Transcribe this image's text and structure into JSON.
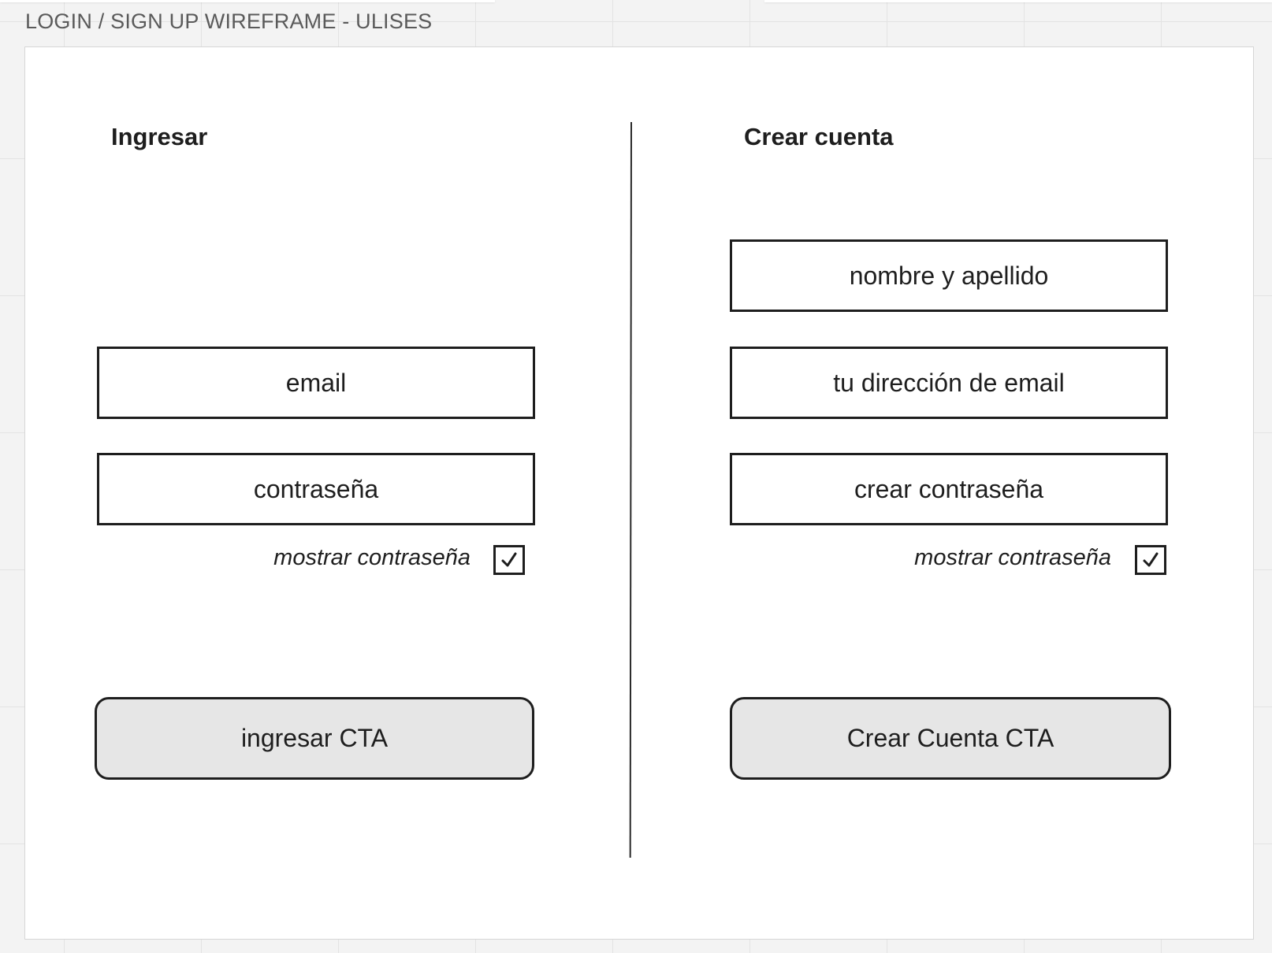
{
  "frame": {
    "title": "LOGIN / SIGN UP WIREFRAME - ULISES"
  },
  "login": {
    "heading": "Ingresar",
    "email_placeholder": "email",
    "password_placeholder": "contraseña",
    "show_password_label": "mostrar contraseña",
    "show_password_checked": true,
    "submit_label": "ingresar CTA"
  },
  "signup": {
    "heading": "Crear cuenta",
    "name_placeholder": "nombre y apellido",
    "email_placeholder": "tu dirección de email",
    "password_placeholder": "crear contraseña",
    "show_password_label": "mostrar contraseña",
    "show_password_checked": true,
    "submit_label": "Crear Cuenta CTA"
  },
  "icons": {
    "checkbox_mark": "checkmark-icon"
  },
  "colors": {
    "stroke": "#1e1e1e",
    "cta_fill": "#e6e6e6",
    "canvas": "#f3f3f3",
    "frame_fill": "#ffffff"
  }
}
